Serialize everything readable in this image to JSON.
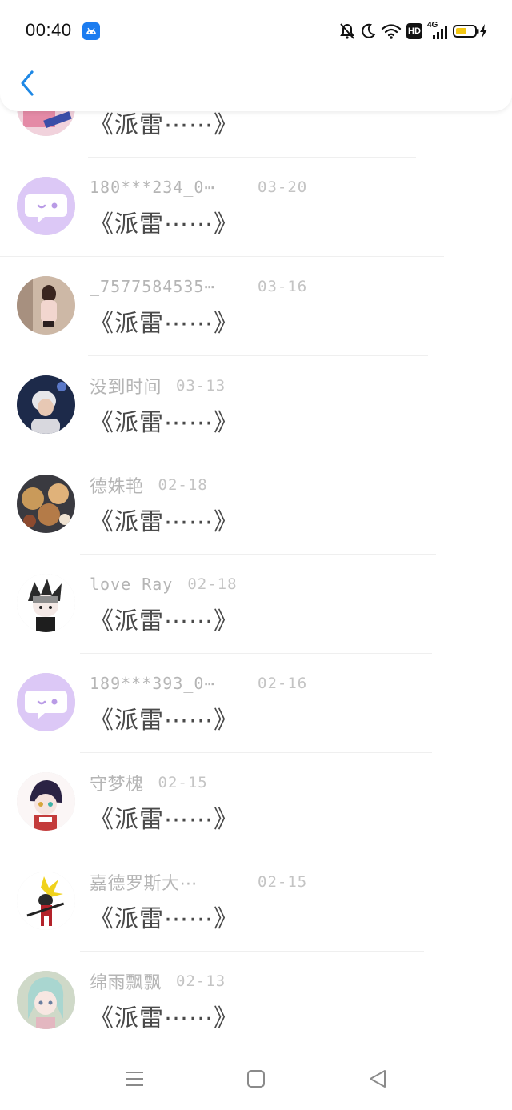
{
  "status_bar": {
    "time": "00:40",
    "hd_label": "HD",
    "network_label": "4G"
  },
  "header": {
    "back_icon": "chevron-left-icon"
  },
  "list": {
    "items": [
      {
        "name": "",
        "date": "",
        "message": "《派雷⋯⋯》"
      },
      {
        "name": "180***234_0⋯",
        "date": "03-20",
        "message": "《派雷⋯⋯》"
      },
      {
        "name": "_7577584535⋯",
        "date": "03-16",
        "message": "《派雷⋯⋯》"
      },
      {
        "name": "没到时间",
        "date": "03-13",
        "message": "《派雷⋯⋯》"
      },
      {
        "name": "德姝艳",
        "date": "02-18",
        "message": "《派雷⋯⋯》"
      },
      {
        "name": "love Ray",
        "date": "02-18",
        "message": "《派雷⋯⋯》"
      },
      {
        "name": "189***393_0⋯",
        "date": "02-16",
        "message": "《派雷⋯⋯》"
      },
      {
        "name": "守梦槐",
        "date": "02-15",
        "message": "《派雷⋯⋯》"
      },
      {
        "name": "嘉德罗斯大⋯",
        "date": "02-15",
        "message": "《派雷⋯⋯》"
      },
      {
        "name": "绵雨飘飘",
        "date": "02-13",
        "message": "《派雷⋯⋯》"
      }
    ]
  },
  "nav_bar": {
    "icons": [
      "menu-icon",
      "home-square-icon",
      "back-triangle-icon"
    ]
  },
  "colors": {
    "accent": "#1e88e5",
    "default_avatar_bg": "#d9c6f5"
  }
}
